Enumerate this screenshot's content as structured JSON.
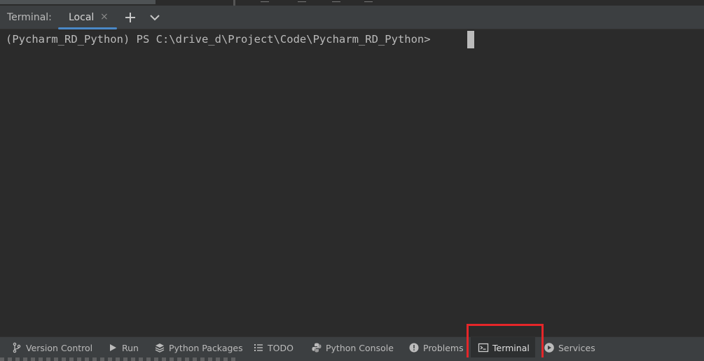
{
  "terminal": {
    "title": "Terminal:",
    "tabs": [
      {
        "label": "Local",
        "close": "×",
        "active": true
      }
    ],
    "new_tab_icon": "plus-icon",
    "dropdown_icon": "chevron-down-icon",
    "prompt": "(Pycharm_RD_Python) PS C:\\drive_d\\Project\\Code\\Pycharm_RD_Python> "
  },
  "tool_windows": [
    {
      "label": "Version Control",
      "icon": "branch-icon"
    },
    {
      "label": "Run",
      "icon": "play-icon"
    },
    {
      "label": "Python Packages",
      "icon": "layers-icon"
    },
    {
      "label": "TODO",
      "icon": "list-icon"
    },
    {
      "label": "Python Console",
      "icon": "python-icon"
    },
    {
      "label": "Problems",
      "icon": "warning-icon"
    },
    {
      "label": "Terminal",
      "icon": "terminal-icon",
      "active": true
    },
    {
      "label": "Services",
      "icon": "services-icon"
    }
  ],
  "colors": {
    "accent": "#4a88c7",
    "highlight": "#e52629",
    "background": "#2b2b2b",
    "toolbar": "#3c3f41"
  }
}
